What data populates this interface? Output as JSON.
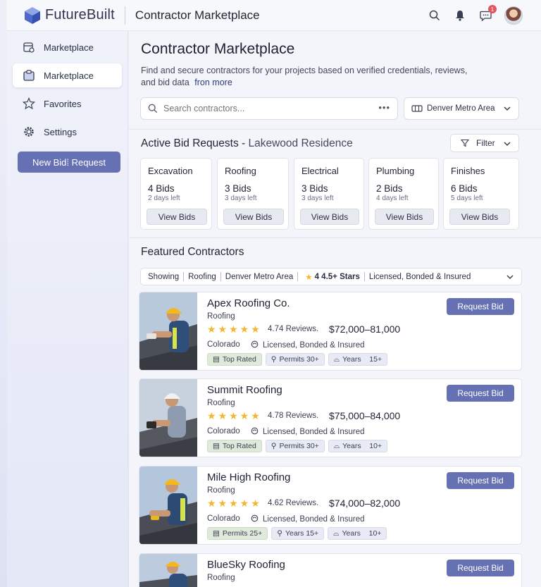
{
  "app": {
    "name": "FutureBuilt",
    "page_title": "Contractor Marketplace"
  },
  "topbar": {
    "notification_count": "1"
  },
  "sidebar": {
    "items": [
      {
        "label": "Marketplace",
        "icon": "calendar-gear-icon"
      },
      {
        "label": "Marketplace",
        "icon": "clipboard-icon",
        "active": true
      },
      {
        "label": "Favorites",
        "icon": "star-icon"
      },
      {
        "label": "Settings",
        "icon": "gear-icon"
      }
    ],
    "new_bid_label": "New Bid⁞ Request"
  },
  "main": {
    "title": "Contractor Marketplace",
    "subtitle": "Find and secure contractors for your projects based on verified credentials, reviews, and bid data",
    "subtitle_link": "fron more",
    "search_placeholder": "Search contractors...",
    "location": "Denver Metro Area",
    "bids_title": "Active Bid Requests -",
    "bids_project": "Lakewood Residence",
    "filter_label": "Filter",
    "bid_cards": [
      {
        "category": "Excavation",
        "bids": "4 Bids",
        "left": "2 days left",
        "button": "View Bids"
      },
      {
        "category": "Roofing",
        "bids": "3 Bids",
        "left": "3 days left",
        "button": "View Bids"
      },
      {
        "category": "Electrical",
        "bids": "3 Bids",
        "left": "3 days left",
        "button": "View Bids"
      },
      {
        "category": "Plumbing",
        "bids": "2 Bids",
        "left": "4 days left",
        "button": "View Bids"
      },
      {
        "category": "Finishes",
        "bids": "6 Bids",
        "left": "5 days left",
        "button": "View Bids"
      }
    ],
    "featured_title": "Featured Contractors",
    "showing": {
      "label": "Showing",
      "trade": "Roofing",
      "area": "Denver Metro Area",
      "rating": "4 4.5+ Stars",
      "license": "Licensed, Bonded & Insured"
    },
    "contractors": [
      {
        "name": "Apex Roofing Co.",
        "trade": "Roofing",
        "stars": "★★★★★",
        "reviews": "4.74 Reviews.",
        "price": "$72,000–81,000",
        "location": "Colorado",
        "license": "Licensed, Bonded & Insured",
        "tags": [
          "Top Rated",
          "Permits 30+",
          "Years    15+"
        ],
        "button": "Request Bid"
      },
      {
        "name": "Summit Roofing",
        "trade": "Roofing",
        "stars": "★★★★★",
        "reviews": "4.78 Reviews.",
        "price": "$75,000–84,000",
        "location": "Colorado",
        "license": "Licensed, Bonded & Insured",
        "tags": [
          "Top Rated",
          "Permits 30+",
          "Years    10+"
        ],
        "button": "Request Bid"
      },
      {
        "name": "Mile High Roofing",
        "trade": "Roofing",
        "stars": "★★★★★",
        "reviews": "4.62 Reviews.",
        "price": "$74,000–82,000",
        "location": "Colorado",
        "license": "Licensed, Bonded & Insured",
        "tags": [
          "Permits 25+",
          "Years 15+",
          "Years    10+"
        ],
        "button": "Request Bid"
      },
      {
        "name": "BlueSky Roofing",
        "trade": "Roofing",
        "stars": "",
        "reviews": "",
        "price": "",
        "location": "",
        "license": "",
        "tags": [],
        "button": "Request Bid"
      }
    ]
  }
}
